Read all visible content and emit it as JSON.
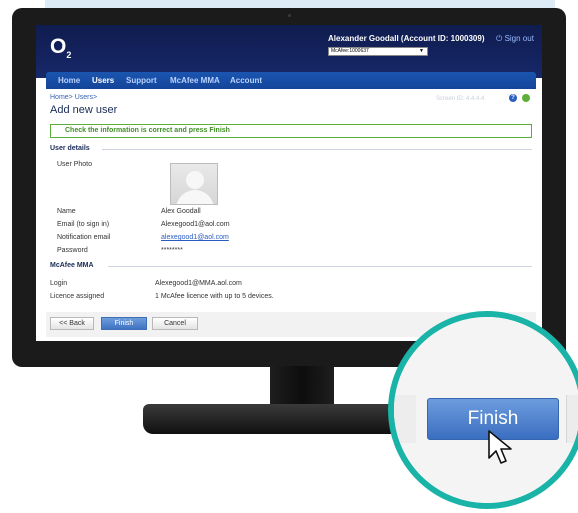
{
  "header": {
    "logo": "O",
    "logo_sub": "2",
    "user_name": "Alexander Goodall (Account ID: 1000309)",
    "signout": "Sign out",
    "account_select": "McAfee:1000637"
  },
  "nav": {
    "items": [
      "Home",
      "Users",
      "Support",
      "McAfee MMA",
      "Account"
    ],
    "active": "Users"
  },
  "content": {
    "breadcrumb": "Home> Users>",
    "screen_id": "Screen ID: 4.4.4.4",
    "help": "?",
    "title": "Add new user",
    "notice": "Check the information is correct and press Finish"
  },
  "user_details": {
    "heading": "User details",
    "fields": [
      {
        "label": "User Photo",
        "value": ""
      },
      {
        "label": "Name",
        "value": "Alex Goodall"
      },
      {
        "label": "Email (to sign in)",
        "value": "Alexegood1@aol.com"
      },
      {
        "label": "Notification email",
        "value": "alexegood1@aol.com"
      },
      {
        "label": "Password",
        "value": "********"
      }
    ]
  },
  "mcafee": {
    "heading": "McAfee MMA",
    "fields": [
      {
        "label": "Login",
        "value": "Alexegood1@MMA.aol.com"
      },
      {
        "label": "Licence assigned",
        "value": "1 McAfee licence with up to 5 devices."
      }
    ]
  },
  "buttons": {
    "back": "<< Back",
    "finish": "Finish",
    "cancel": "Cancel"
  },
  "zoom": {
    "finish": "Finish"
  },
  "colors": {
    "accent_teal": "#19b3a8",
    "brand_navy": "#0f1c4e",
    "nav_blue": "#1b56b0",
    "notice_green": "#3f8f24",
    "primary_button": "#3f73c2"
  }
}
